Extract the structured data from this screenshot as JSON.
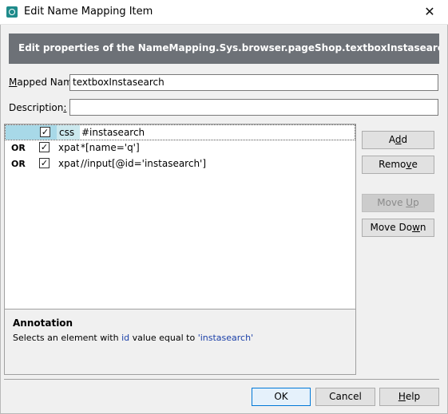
{
  "window": {
    "title": "Edit Name Mapping Item",
    "close_glyph": "✕"
  },
  "banner": {
    "text": "Edit properties of the NameMapping.Sys.browser.pageShop.textboxInstasearch item (Sys.B"
  },
  "form": {
    "mapped_name_label_pre": "",
    "mapped_name_label_u": "M",
    "mapped_name_label_post": "apped Name:",
    "mapped_name_value": "textboxInstasearch",
    "description_label_pre": "Description",
    "description_label_u": ":",
    "description_value": ""
  },
  "criteria": [
    {
      "op": "",
      "checked": true,
      "type": "css",
      "value": "#instasearch"
    },
    {
      "op": "OR",
      "checked": true,
      "type": "xpath",
      "value": "*[name='q']"
    },
    {
      "op": "OR",
      "checked": true,
      "type": "xpath",
      "value": "//input[@id='instasearch']"
    }
  ],
  "annotation": {
    "title": "Annotation",
    "text_pre": "Selects an element with ",
    "text_attr": "id",
    "text_mid": " value equal to ",
    "text_value": "'instasearch'"
  },
  "side_buttons": {
    "add_pre": "A",
    "add_u": "d",
    "add_post": "d",
    "remove_pre": "Remo",
    "remove_u": "v",
    "remove_post": "e",
    "move_up_pre": "Move ",
    "move_up_u": "U",
    "move_up_post": "p",
    "move_down_pre": "Move Do",
    "move_down_u": "w",
    "move_down_post": "n"
  },
  "footer_buttons": {
    "ok": "OK",
    "cancel": "Cancel",
    "help_pre": "",
    "help_u": "H",
    "help_post": "elp"
  },
  "colors": {
    "banner_bg": "#6d7177",
    "selected_row_highlight": "#a8d9e8",
    "annotation_highlight": "#1a3fa8",
    "default_button_border": "#0078d7"
  },
  "icons": {
    "app": "testcomplete-app-icon",
    "check": "✓"
  }
}
